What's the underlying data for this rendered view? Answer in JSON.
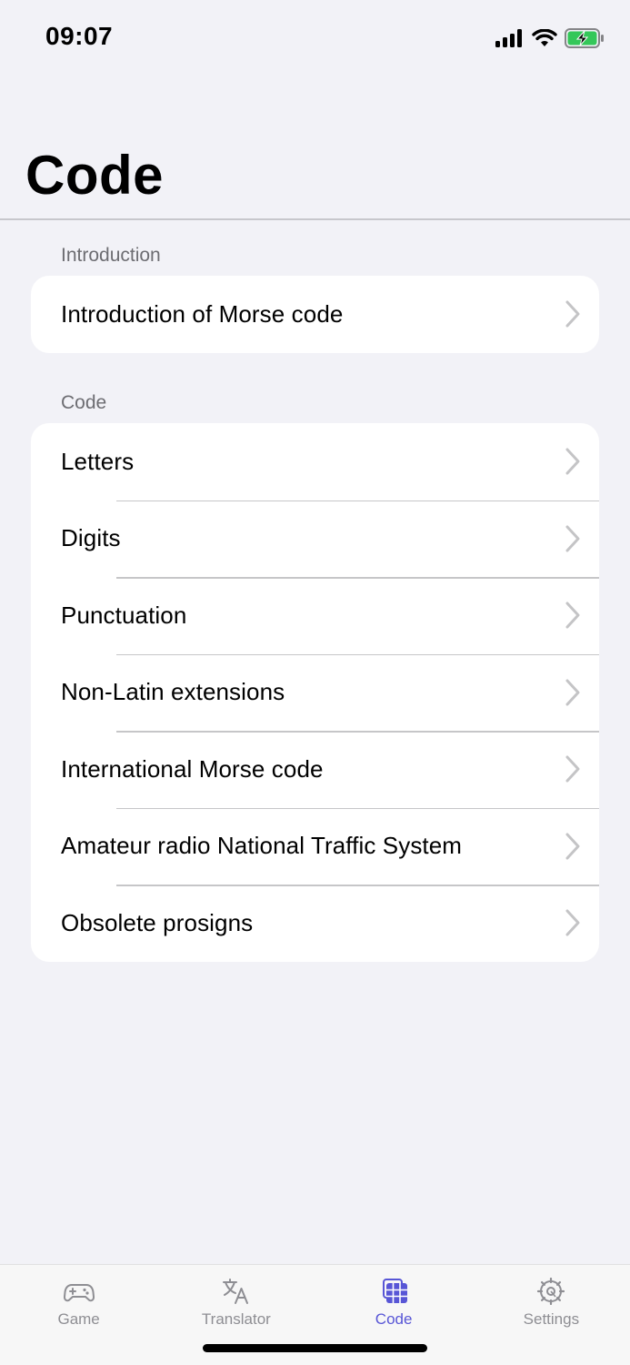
{
  "status_bar": {
    "time": "09:07",
    "icons": [
      "cellular-signal-icon",
      "wifi-icon",
      "battery-charging-icon"
    ]
  },
  "page": {
    "title": "Code"
  },
  "sections": [
    {
      "header": "Introduction",
      "items": [
        {
          "label": "Introduction of Morse code"
        }
      ]
    },
    {
      "header": "Code",
      "items": [
        {
          "label": "Letters"
        },
        {
          "label": "Digits"
        },
        {
          "label": "Punctuation"
        },
        {
          "label": "Non-Latin extensions"
        },
        {
          "label": "International Morse code"
        },
        {
          "label": "Amateur radio National Traffic System"
        },
        {
          "label": "Obsolete prosigns"
        }
      ]
    }
  ],
  "tab_bar": {
    "active": "Code",
    "accent_color": "#5856d6",
    "inactive_color": "#8e8e93",
    "tabs": [
      {
        "label": "Game",
        "icon": "game-controller-icon"
      },
      {
        "label": "Translator",
        "icon": "translate-icon"
      },
      {
        "label": "Code",
        "icon": "code-table-icon"
      },
      {
        "label": "Settings",
        "icon": "gear-icon"
      }
    ]
  }
}
